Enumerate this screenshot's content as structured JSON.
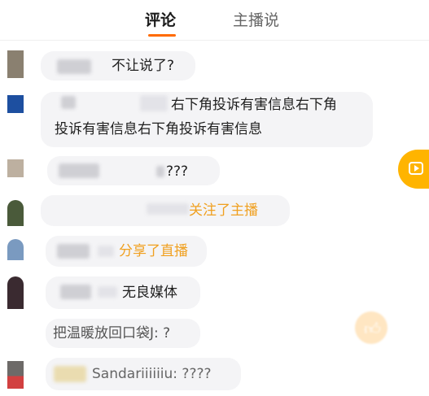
{
  "tabs": {
    "comments": "评论",
    "host_says": "主播说"
  },
  "messages": {
    "m1": {
      "text": "不让说了?"
    },
    "m2": {
      "line1": "右下角投诉有害信息右下角",
      "line2": "投诉有害信息右下角投诉有害信息"
    },
    "m3": {
      "text": "???"
    },
    "m4": {
      "text": "关注了主播"
    },
    "m5": {
      "text": "分享了直播"
    },
    "m6": {
      "text": "无良媒体"
    },
    "m7": {
      "text": "把温暖放回口袋J: ?"
    },
    "m8": {
      "text": "Sandariiiiiiu: ????"
    }
  },
  "colors": {
    "accent": "#ff6a00",
    "highlight": "#f0a020",
    "side_button": "#ffb400"
  },
  "icons": {
    "side_button": "live-video-icon",
    "like": "thumbs-up-icon"
  }
}
